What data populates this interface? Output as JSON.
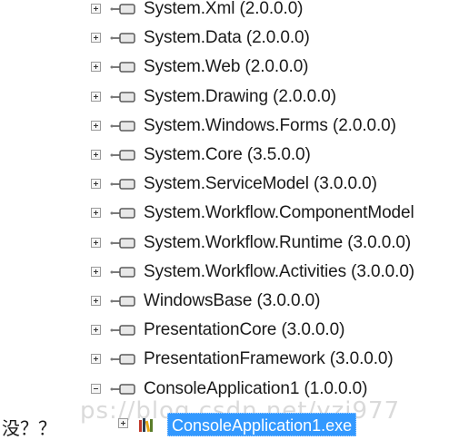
{
  "tree": {
    "items": [
      {
        "label": "System.Xml (2.0.0.0)",
        "expanded": false
      },
      {
        "label": "System.Data (2.0.0.0)",
        "expanded": false
      },
      {
        "label": "System.Web (2.0.0.0)",
        "expanded": false
      },
      {
        "label": "System.Drawing (2.0.0.0)",
        "expanded": false
      },
      {
        "label": "System.Windows.Forms (2.0.0.0)",
        "expanded": false
      },
      {
        "label": "System.Core (3.5.0.0)",
        "expanded": false
      },
      {
        "label": "System.ServiceModel (3.0.0.0)",
        "expanded": false
      },
      {
        "label": "System.Workflow.ComponentModel",
        "expanded": false
      },
      {
        "label": "System.Workflow.Runtime (3.0.0.0)",
        "expanded": false
      },
      {
        "label": "System.Workflow.Activities (3.0.0.0)",
        "expanded": false
      },
      {
        "label": "WindowsBase (3.0.0.0)",
        "expanded": false
      },
      {
        "label": "PresentationCore (3.0.0.0)",
        "expanded": false
      },
      {
        "label": "PresentationFramework (3.0.0.0)",
        "expanded": false
      },
      {
        "label": "ConsoleApplication1 (1.0.0.0)",
        "expanded": true
      }
    ],
    "selected_child": {
      "label": "ConsoleApplication1.exe",
      "expanded": false
    }
  },
  "caption": "没？？",
  "watermark": "ps://blog.csdn.net/yzj977",
  "colors": {
    "selection": "#3399ff",
    "text": "#1a1a1a"
  }
}
